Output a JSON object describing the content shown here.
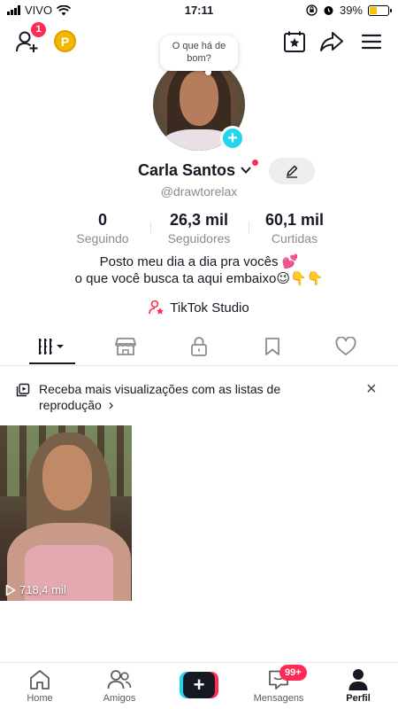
{
  "status_bar": {
    "carrier": "VIVO",
    "time": "17:11",
    "battery": "39%",
    "battery_level": 0.39,
    "icons": [
      "signal-icon",
      "wifi-icon",
      "rotation-lock-icon",
      "alarm-icon",
      "battery-icon"
    ]
  },
  "header": {
    "add_friends_badge": "1",
    "coin_label": "P",
    "icons": [
      "add-friend-icon",
      "coin-icon",
      "star-calendar-icon",
      "share-icon",
      "menu-icon"
    ]
  },
  "profile": {
    "bubble_text": "O que há de bom?",
    "name": "Carla Santos",
    "handle": "@drawtorelax",
    "stats": [
      {
        "value": "0",
        "label": "Seguindo"
      },
      {
        "value": "26,3 mil",
        "label": "Seguidores"
      },
      {
        "value": "60,1 mil",
        "label": "Curtidas"
      }
    ],
    "bio_line1": "Posto meu dia a dia pra vocês 💕",
    "bio_line2": "o que você busca ta aqui embaixo😉👇👇",
    "studio_label": "TikTok Studio"
  },
  "tabs": [
    {
      "icon": "videos-grid-icon",
      "active": true
    },
    {
      "icon": "shop-icon",
      "active": false
    },
    {
      "icon": "lock-icon",
      "active": false
    },
    {
      "icon": "bookmark-icon",
      "active": false
    },
    {
      "icon": "heart-icon",
      "active": false
    }
  ],
  "banner": {
    "text": "Receba mais visualizações com as listas de reprodução",
    "chevron": "›",
    "close": "×"
  },
  "videos": [
    {
      "views": "718,4 mil"
    }
  ],
  "bottom_nav": {
    "items": [
      {
        "label": "Home",
        "icon": "home-icon"
      },
      {
        "label": "Amigos",
        "icon": "friends-icon"
      },
      {
        "label": "",
        "icon": "create-icon"
      },
      {
        "label": "Mensagens",
        "icon": "messages-icon"
      },
      {
        "label": "Perfil",
        "icon": "profile-icon"
      }
    ],
    "messages_badge": "99+"
  },
  "colors": {
    "accent_red": "#fe2c55",
    "accent_cyan": "#20d5ec",
    "text": "#161823",
    "secondary_text": "#8a8b91"
  }
}
